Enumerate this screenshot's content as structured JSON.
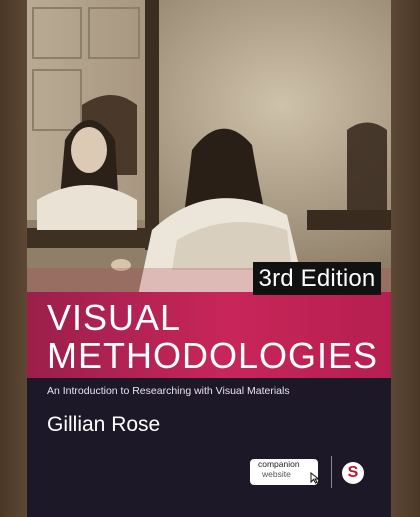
{
  "book": {
    "edition": "3rd Edition",
    "title_line1": "VISUAL",
    "title_line2": "METHODOLOGIES",
    "subtitle": "An Introduction to Researching with Visual Materials",
    "author": "Gillian Rose"
  },
  "badges": {
    "companion_line1": "companion",
    "companion_line2": "website",
    "publisher_logo": "S"
  },
  "colors": {
    "background": "#5b4634",
    "band": "#c8265a",
    "bottom": "#1c1827"
  },
  "icons": [
    "cursor-icon",
    "sage-logo-icon"
  ]
}
